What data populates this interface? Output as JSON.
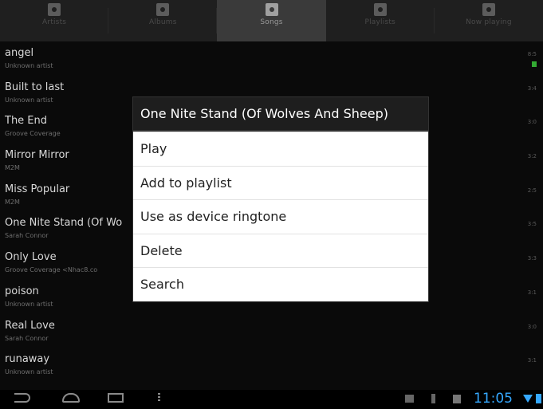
{
  "tabs": [
    {
      "label": "Artists",
      "icon": "artist-icon",
      "selected": false
    },
    {
      "label": "Albums",
      "icon": "album-icon",
      "selected": false
    },
    {
      "label": "Songs",
      "icon": "song-icon",
      "selected": true
    },
    {
      "label": "Playlists",
      "icon": "playlist-icon",
      "selected": false
    },
    {
      "label": "Now playing",
      "icon": "now-playing-icon",
      "selected": false
    }
  ],
  "songs": [
    {
      "title": "angel",
      "artist": "Unknown artist",
      "duration": "8:5"
    },
    {
      "title": "Built to last",
      "artist": "Unknown artist",
      "duration": "3:4"
    },
    {
      "title": "The End",
      "artist": "Groove Coverage",
      "duration": "3:0"
    },
    {
      "title": "Mirror Mirror",
      "artist": "M2M",
      "duration": "3:2"
    },
    {
      "title": "Miss Popular",
      "artist": "M2M",
      "duration": "2:5"
    },
    {
      "title": "One Nite Stand (Of Wo",
      "artist": "Sarah Connor",
      "duration": "3:5"
    },
    {
      "title": "Only Love",
      "artist": "Groove Coverage <Nhac8.co",
      "duration": "3:3"
    },
    {
      "title": "poison",
      "artist": "Unknown artist",
      "duration": "3:1"
    },
    {
      "title": "Real Love",
      "artist": "Sarah Connor",
      "duration": "3:0"
    },
    {
      "title": "runaway",
      "artist": "Unknown artist",
      "duration": "3:1"
    }
  ],
  "dialog": {
    "title": "One Nite Stand (Of Wolves And Sheep)",
    "items": [
      "Play",
      "Add to playlist",
      "Use as device ringtone",
      "Delete",
      "Search"
    ]
  },
  "status": {
    "time": "11:05"
  },
  "colors": {
    "accent": "#35a8ff",
    "playing_indicator": "#33aa33"
  }
}
